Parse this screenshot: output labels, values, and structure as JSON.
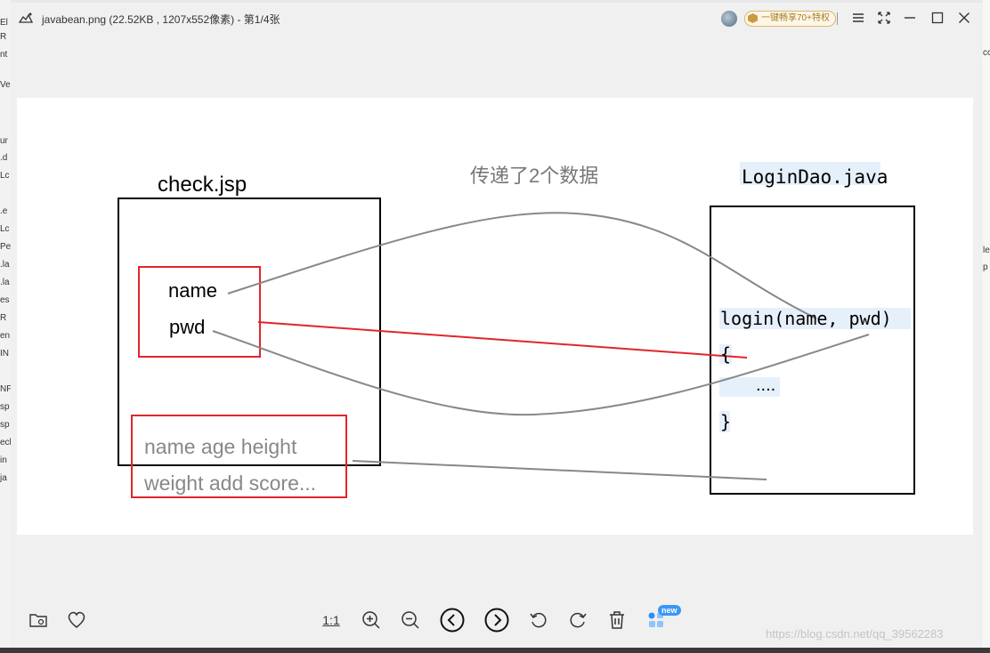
{
  "viewer": {
    "title": "javabean.png (22.52KB , 1207x552像素) - 第1/4张",
    "vip_label": "一键畅享70+特权"
  },
  "left_strip": [
    "El",
    "R",
    "nt",
    "Ve",
    "ur",
    ".d",
    "Lc",
    ".e",
    "Lc",
    "Pe",
    ".la",
    ".la",
    "es",
    "R",
    "en",
    "IN",
    "NF",
    "sp",
    "sp",
    "ecl",
    "in",
    "ja"
  ],
  "right_strip": [
    "cc",
    "le",
    "p"
  ],
  "image": {
    "left_box_label": "check.jsp",
    "right_box_label": "LoginDao.java",
    "transfer_label": "传递了2个数据",
    "field_name": "name",
    "field_pwd": "pwd",
    "extra_line1": "name  age height",
    "extra_line2": "weight add score...",
    "code_sig": "login(name, pwd)",
    "code_open": "{",
    "code_body": "....",
    "code_close": "}"
  },
  "toolbar": {
    "zoom_label": "1:1",
    "new_badge": "new"
  },
  "watermark": "https://blog.csdn.net/qq_39562283",
  "colors": {
    "accent_red": "#e0262b",
    "curve_gray": "#8a8a8a",
    "code_highlight": "#e6f0fb"
  }
}
